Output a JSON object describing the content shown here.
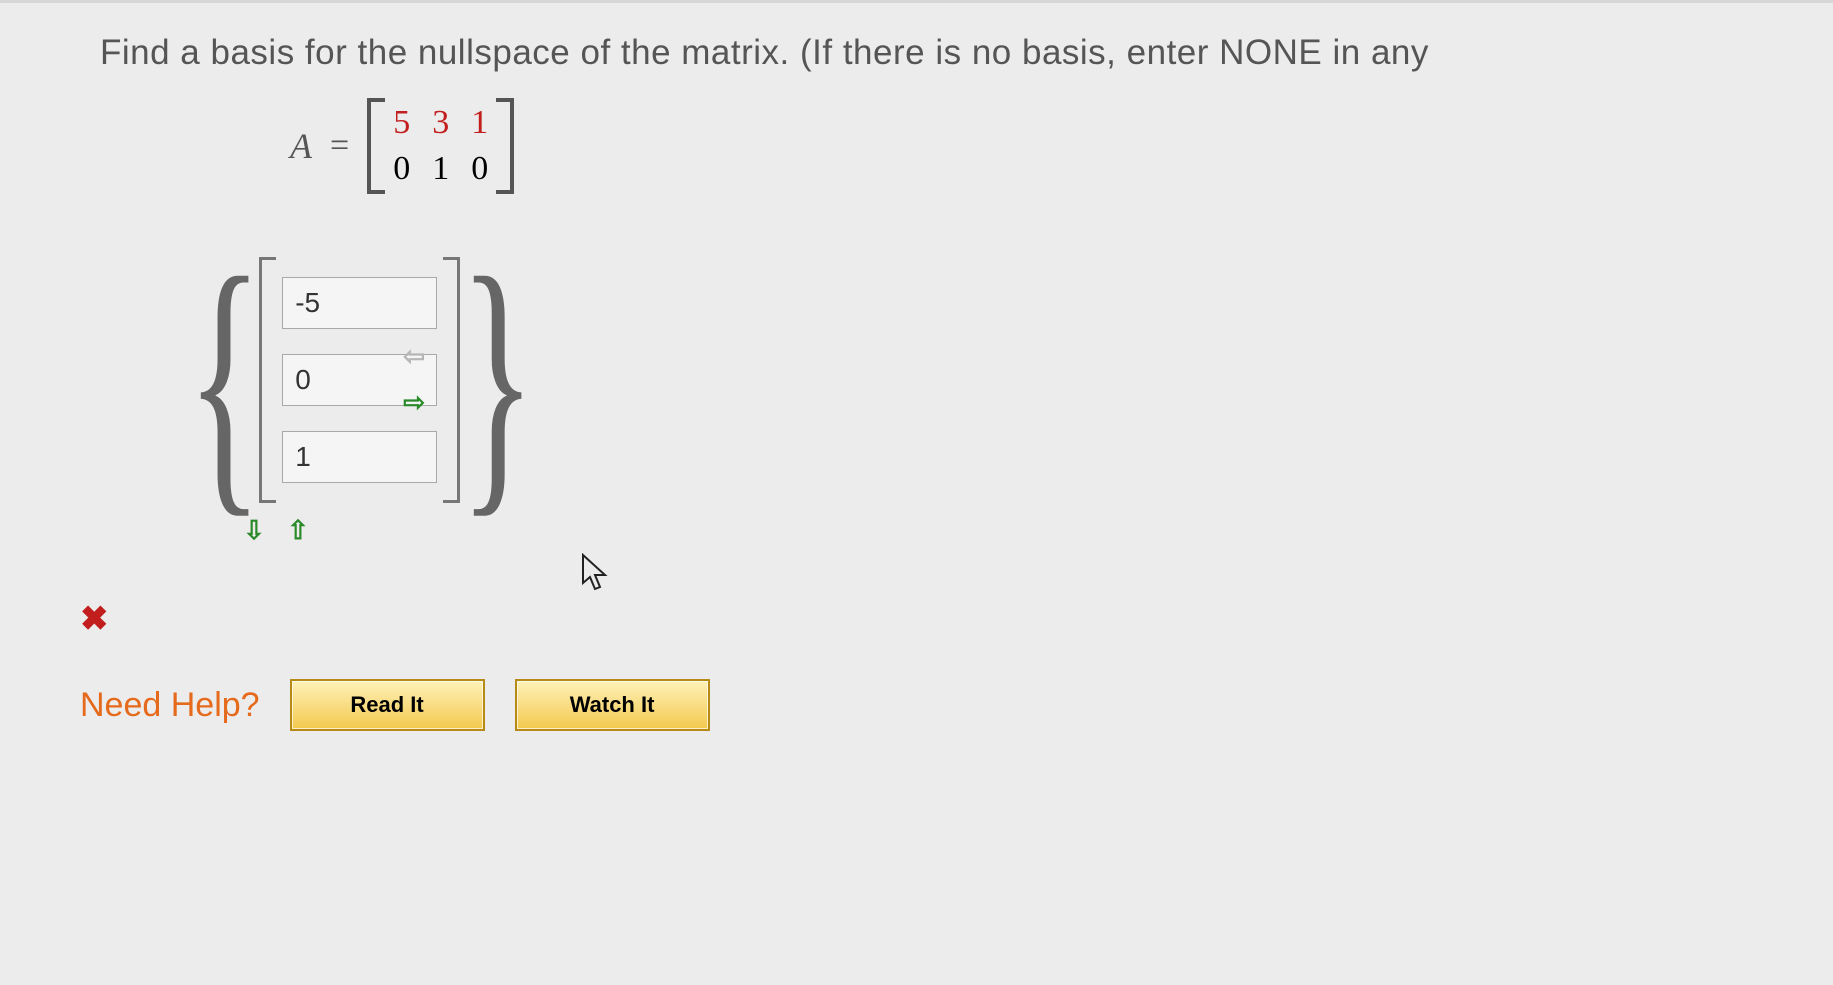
{
  "question": {
    "text": "Find a basis for the nullspace of the matrix. (If there is no basis, enter NONE in any",
    "matrix_label": "A",
    "equals": "=",
    "matrix": {
      "r1c1": "5",
      "r1c2": "3",
      "r1c3": "1",
      "r2c1": "0",
      "r2c2": "1",
      "r2c3": "0"
    }
  },
  "answer": {
    "values": [
      "-5",
      "0",
      "1"
    ]
  },
  "status": {
    "incorrect_icon": "✖"
  },
  "help": {
    "label": "Need Help?",
    "read_label": "Read It",
    "watch_label": "Watch It"
  },
  "arrows": {
    "left": "⇦",
    "right": "⇨",
    "down": "⇩",
    "up": "⇧"
  }
}
